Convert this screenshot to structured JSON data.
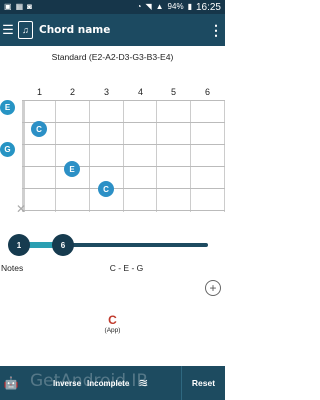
{
  "status_bar": {
    "battery": "94%",
    "time": "16:25"
  },
  "app_bar": {
    "menu_icon": "hamburger-icon",
    "title": "Chord name",
    "overflow_icon": "more-vert-icon"
  },
  "tuning": "Standard (E2-A2-D3-G3-B3-E4)",
  "fret_numbers": [
    "1",
    "2",
    "3",
    "4",
    "5",
    "6"
  ],
  "strings": [
    "E",
    "G"
  ],
  "dots": [
    "C",
    "E",
    "C"
  ],
  "mute_symbol": "✕",
  "range": {
    "start": "1",
    "end": "6"
  },
  "notes": {
    "label": "Notes",
    "value": "C - E - G"
  },
  "chord": {
    "name": "C",
    "source": "(App)"
  },
  "bottom_bar": {
    "inverse_label": "Inverse",
    "incomplete_label": "Incomplete",
    "reset_label": "Reset"
  },
  "watermark": "GetAndroid.IR",
  "colors": {
    "app_bar": "#1c4a61",
    "status_bar": "#16364a",
    "dot": "#2c90c6",
    "chord_name": "#c0392b"
  }
}
